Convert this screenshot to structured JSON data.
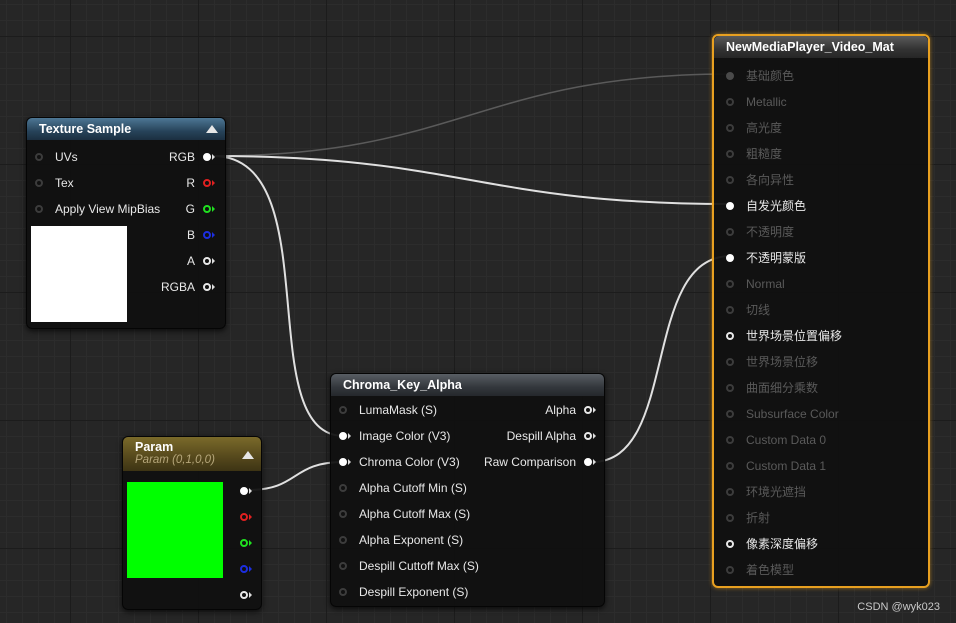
{
  "texture_sample": {
    "title": "Texture Sample",
    "inputs": [
      {
        "label": "UVs"
      },
      {
        "label": "Tex"
      },
      {
        "label": "Apply View MipBias"
      }
    ],
    "outputs": [
      {
        "label": "RGB"
      },
      {
        "label": "R"
      },
      {
        "label": "G"
      },
      {
        "label": "B"
      },
      {
        "label": "A"
      },
      {
        "label": "RGBA"
      }
    ],
    "preview_color": "#ffffff"
  },
  "param": {
    "title": "Param",
    "subtitle": "Param (0,1,0,0)",
    "preview_color": "#00ff00"
  },
  "chroma": {
    "title": "Chroma_Key_Alpha",
    "inputs": [
      {
        "label": "LumaMask (S)"
      },
      {
        "label": "Image Color (V3)"
      },
      {
        "label": "Chroma Color (V3)"
      },
      {
        "label": "Alpha Cutoff Min (S)"
      },
      {
        "label": "Alpha Cutoff Max (S)"
      },
      {
        "label": "Alpha Exponent (S)"
      },
      {
        "label": "Despill Cuttoff Max (S)"
      },
      {
        "label": "Despill Exponent (S)"
      }
    ],
    "outputs": [
      {
        "label": "Alpha"
      },
      {
        "label": "Despill Alpha"
      },
      {
        "label": "Raw Comparison"
      }
    ]
  },
  "material": {
    "title": "NewMediaPlayer_Video_Mat",
    "pins": [
      {
        "label": "基础颜色"
      },
      {
        "label": "Metallic"
      },
      {
        "label": "高光度"
      },
      {
        "label": "粗糙度"
      },
      {
        "label": "各向异性"
      },
      {
        "label": "自发光颜色"
      },
      {
        "label": "不透明度"
      },
      {
        "label": "不透明蒙版"
      },
      {
        "label": "Normal"
      },
      {
        "label": "切线"
      },
      {
        "label": "世界场景位置偏移"
      },
      {
        "label": "世界场景位移"
      },
      {
        "label": "曲面细分乘数"
      },
      {
        "label": "Subsurface Color"
      },
      {
        "label": "Custom Data 0"
      },
      {
        "label": "Custom Data 1"
      },
      {
        "label": "环境光遮挡"
      },
      {
        "label": "折射"
      },
      {
        "label": "像素深度偏移"
      },
      {
        "label": "着色模型"
      }
    ]
  },
  "watermark": "CSDN @wyk023",
  "colors": {
    "selection_outline": "#e8a020",
    "wire": "#e0e0e0"
  }
}
